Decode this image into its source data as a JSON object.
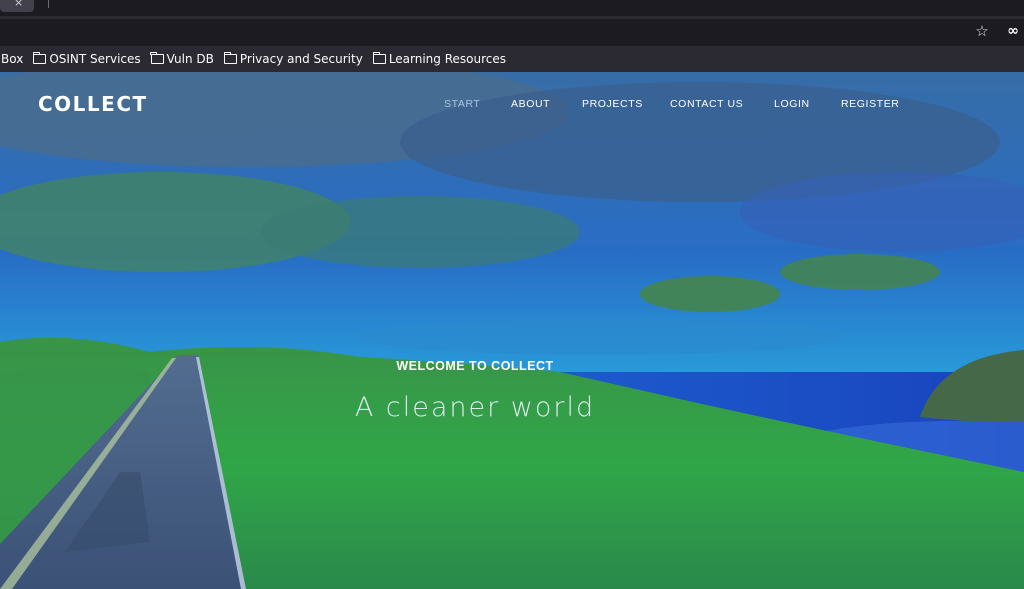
{
  "browser": {
    "bookmarks": [
      {
        "label": "Box",
        "folder": false
      },
      {
        "label": "OSINT Services",
        "folder": true
      },
      {
        "label": "Vuln DB",
        "folder": true
      },
      {
        "label": "Privacy and Security",
        "folder": true
      },
      {
        "label": "Learning Resources",
        "folder": true
      }
    ],
    "tab_close_glyph": "×"
  },
  "site": {
    "brand": "COLLECT",
    "nav": [
      "START",
      "ABOUT",
      "PROJECTS",
      "CONTACT US",
      "LOGIN",
      "REGISTER"
    ],
    "active_nav": "START"
  },
  "hero": {
    "welcome": "WELCOME TO COLLECT",
    "tagline": "A cleaner world"
  },
  "colors": {
    "overlay": "#2a8fd6",
    "grass": "#3aa83c",
    "sea": "#1b4fd8"
  }
}
